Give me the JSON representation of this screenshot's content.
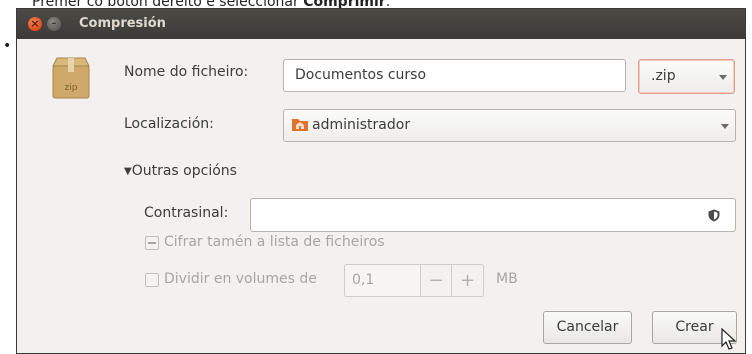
{
  "caption": {
    "prefix": "Premer co botón dereito e seleccionar ",
    "bold": "Comprimir",
    "suffix": "."
  },
  "window": {
    "title": "Compresión"
  },
  "file_icon": {
    "label": "zip",
    "icon": "archive-package-icon"
  },
  "filename": {
    "label": "Nome do ficheiro:",
    "value": "Documentos curso"
  },
  "extension": {
    "selected": ".zip"
  },
  "location": {
    "label": "Localización:",
    "value": "administrador",
    "icon": "home-folder-icon"
  },
  "other_options": {
    "label": "Outras opcións",
    "expanded": true
  },
  "password": {
    "label": "Contrasinal:",
    "value": "",
    "icon": "shield-icon"
  },
  "encrypt_list": {
    "label": "Cifrar tamén a lista de ficheiros",
    "enabled": false
  },
  "split_volumes": {
    "label": "Dividir en volumes de",
    "value": "0,1",
    "minus": "−",
    "plus": "+",
    "unit": "MB",
    "enabled": false
  },
  "buttons": {
    "cancel": "Cancelar",
    "create": "Crear"
  },
  "colors": {
    "accent": "#df4a16",
    "titlebar": "#3c3b37",
    "dialog_bg": "#f2f1f0"
  }
}
